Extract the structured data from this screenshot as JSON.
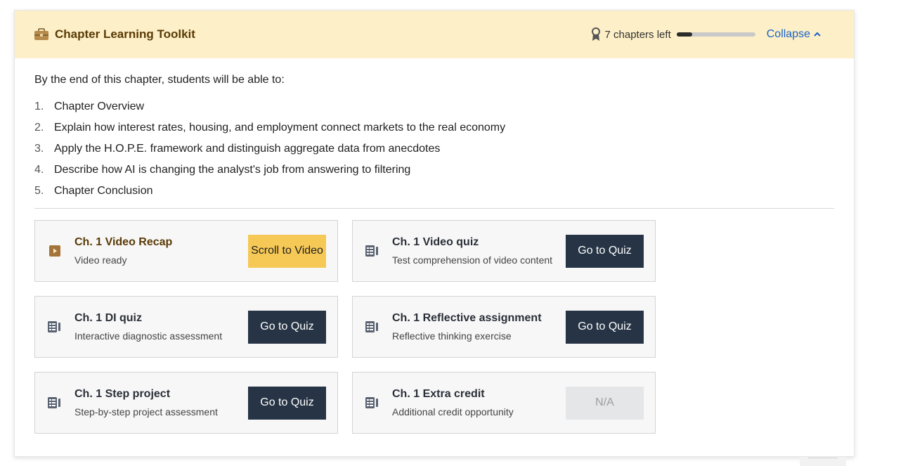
{
  "header": {
    "title": "Chapter Learning Toolkit",
    "chapters_left": "7 chapters left",
    "progress_fraction": 0.2,
    "collapse_label": "Collapse"
  },
  "objectives": {
    "intro": "By the end of this chapter, students will be able to:",
    "items": [
      {
        "num": "1.",
        "text": "Chapter Overview"
      },
      {
        "num": "2.",
        "text": "Explain how interest rates, housing, and employment connect markets to the real economy"
      },
      {
        "num": "3.",
        "text": "Apply the H.O.P.E. framework and distinguish aggregate data from anecdotes"
      },
      {
        "num": "4.",
        "text": "Describe how AI is changing the analyst's job from answering to filtering"
      },
      {
        "num": "5.",
        "text": "Chapter Conclusion"
      }
    ]
  },
  "cards": [
    {
      "title": "Ch. 1 Video Recap",
      "subtitle": "Video ready",
      "button": "Scroll to Video",
      "icon": "play-icon"
    },
    {
      "title": "Ch. 1 Video quiz",
      "subtitle": "Test comprehension of video content",
      "button": "Go to Quiz",
      "icon": "quiz-icon"
    },
    {
      "title": "Ch. 1 DI quiz",
      "subtitle": "Interactive diagnostic assessment",
      "button": "Go to Quiz",
      "icon": "quiz-icon"
    },
    {
      "title": "Ch. 1 Reflective assignment",
      "subtitle": "Reflective thinking exercise",
      "button": "Go to Quiz",
      "icon": "quiz-icon"
    },
    {
      "title": "Ch. 1 Step project",
      "subtitle": "Step-by-step project assessment",
      "button": "Go to Quiz",
      "icon": "quiz-icon"
    },
    {
      "title": "Ch. 1 Extra credit",
      "subtitle": "Additional credit opportunity",
      "button": "N/A",
      "icon": "quiz-icon"
    }
  ],
  "colors": {
    "header_bg": "#fdefc7",
    "title_brown": "#5a3a06",
    "link_blue": "#1a63c7",
    "button_dark": "#263445",
    "button_yellow": "#f6c957",
    "button_disabled": "#e5e6e8"
  }
}
